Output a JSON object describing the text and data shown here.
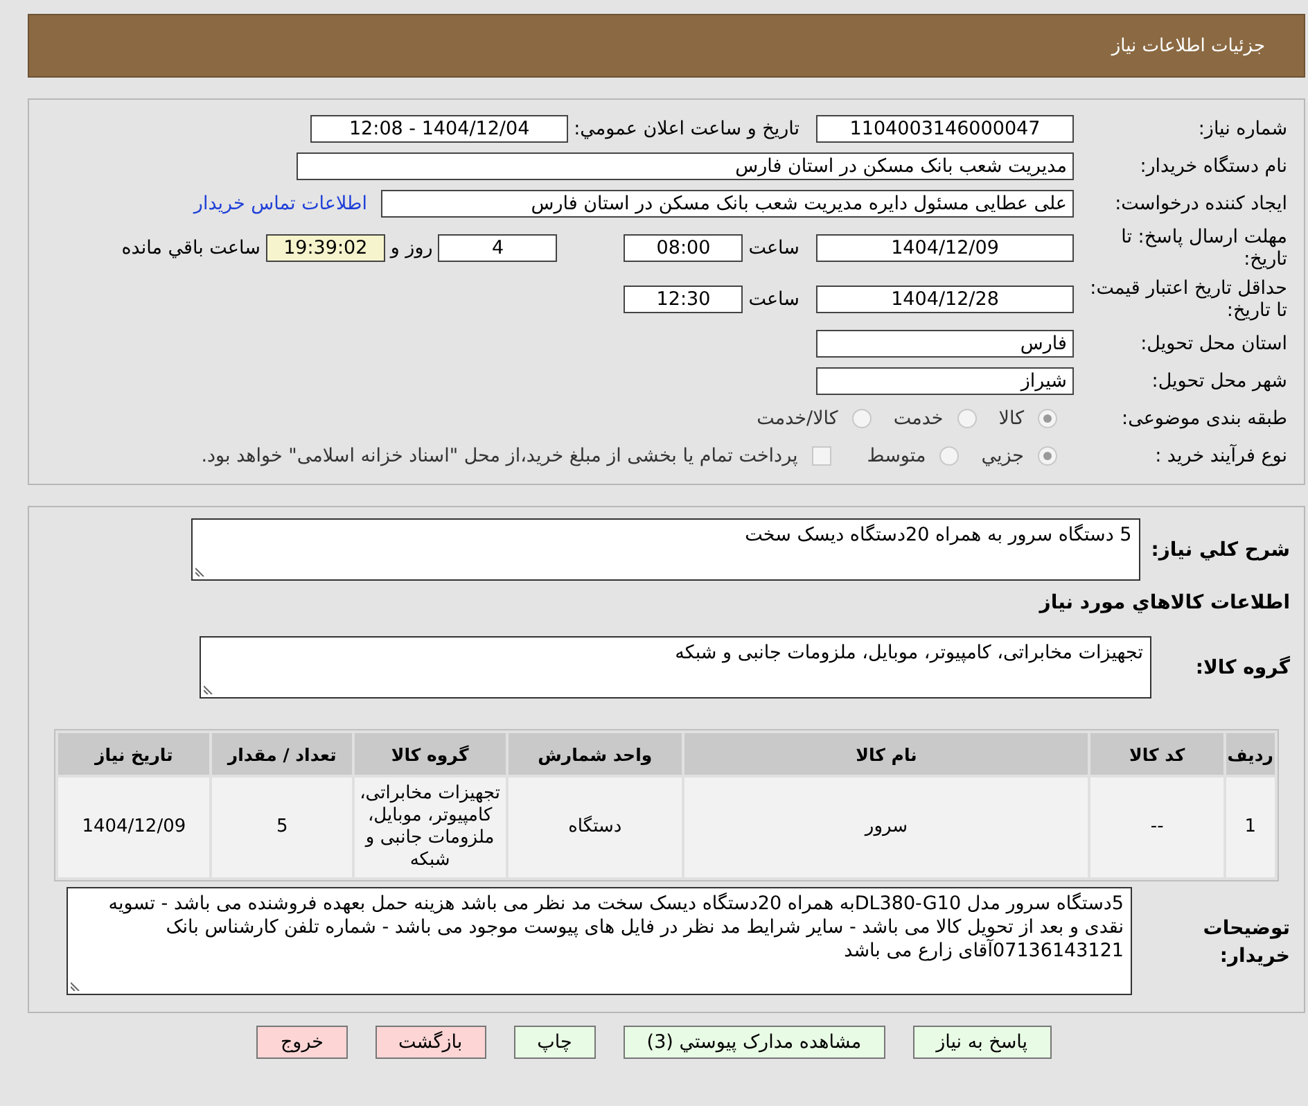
{
  "header": {
    "title": "جزئیات اطلاعات نیاز"
  },
  "need_info": {
    "need_number": {
      "label": "شماره نیاز:",
      "value": "1104003146000047"
    },
    "announce": {
      "label": "تاریخ و ساعت اعلان عمومي:",
      "value": "1404/12/04 - 12:08"
    },
    "buyer_org": {
      "label": "نام دستگاه خریدار:",
      "value": "مدیریت شعب بانک مسکن در استان فارس"
    },
    "requester": {
      "label": "ایجاد کننده درخواست:",
      "value": "علی عطایی مسئول دایره مدیریت شعب بانک مسکن در استان فارس",
      "link": "اطلاعات تماس خریدار"
    },
    "deadline": {
      "label": "مهلت ارسال پاسخ: تا تاریخ:",
      "date": "1404/12/09",
      "time_label": "ساعت",
      "time": "08:00",
      "days": "4",
      "days_label": "روز و",
      "remaining": "19:39:02",
      "remaining_label": "ساعت باقي مانده"
    },
    "validity": {
      "label": "حداقل تاریخ اعتبار قیمت: تا تاریخ:",
      "date": "1404/12/28",
      "time_label": "ساعت",
      "time": "12:30"
    },
    "province": {
      "label": "استان محل تحویل:",
      "value": "فارس"
    },
    "city": {
      "label": "شهر محل تحویل:",
      "value": "شیراز"
    },
    "category": {
      "label": "طبقه بندی موضوعی:",
      "options": [
        {
          "label": "کالا",
          "selected": true
        },
        {
          "label": "خدمت",
          "selected": false
        },
        {
          "label": "کالا/خدمت",
          "selected": false
        }
      ]
    },
    "process": {
      "label": "نوع فرآیند خرید :",
      "options": [
        {
          "label": "جزيي",
          "selected": true
        },
        {
          "label": "متوسط",
          "selected": false
        }
      ],
      "payment": {
        "label": "پرداخت تمام یا بخشی از مبلغ خرید،از محل \"اسناد خزانه اسلامی\" خواهد بود.",
        "checked": false
      }
    }
  },
  "goods": {
    "description": {
      "label": "شرح کلي نياز:",
      "value": "5 دستگاه سرور به همراه 20دستگاه دیسک سخت"
    },
    "section_title": "اطلاعات کالاهاي مورد نياز",
    "group": {
      "label": "گروه کالا:",
      "value": "تجهیزات مخابراتی، کامپیوتر، موبایل، ملزومات جانبی و شبکه"
    },
    "table": {
      "columns": [
        "رديف",
        "کد کالا",
        "نام کالا",
        "واحد شمارش",
        "گروه کالا",
        "تعداد / مقدار",
        "تاریخ نیاز"
      ],
      "rows": [
        [
          "1",
          "--",
          "سرور",
          "دستگاه",
          "تجهیزات مخابراتی، کامپیوتر، موبایل، ملزومات جانبی و شبکه",
          "5",
          "1404/12/09"
        ]
      ]
    },
    "notes": {
      "label": "توضیحات خریدار:",
      "value": "5دستگاه سرور مدل DL380-G10به همراه 20دستگاه دیسک سخت مد نظر می باشد هزینه حمل بعهده فروشنده می باشد - تسویه نقدی و بعد از تحویل کالا می باشد - سایر شرایط مد نظر در فایل های پیوست موجود می باشد - شماره تلفن کارشناس بانک 07136143121آقای زارع می باشد"
    }
  },
  "buttons": [
    {
      "label": "پاسخ به نیاز",
      "kind": "normal"
    },
    {
      "label": "مشاهده مدارک پیوستي (3)",
      "kind": "normal"
    },
    {
      "label": "چاپ",
      "kind": "normal"
    },
    {
      "label": "بازگشت",
      "kind": "danger"
    },
    {
      "label": "خروج",
      "kind": "danger"
    }
  ]
}
